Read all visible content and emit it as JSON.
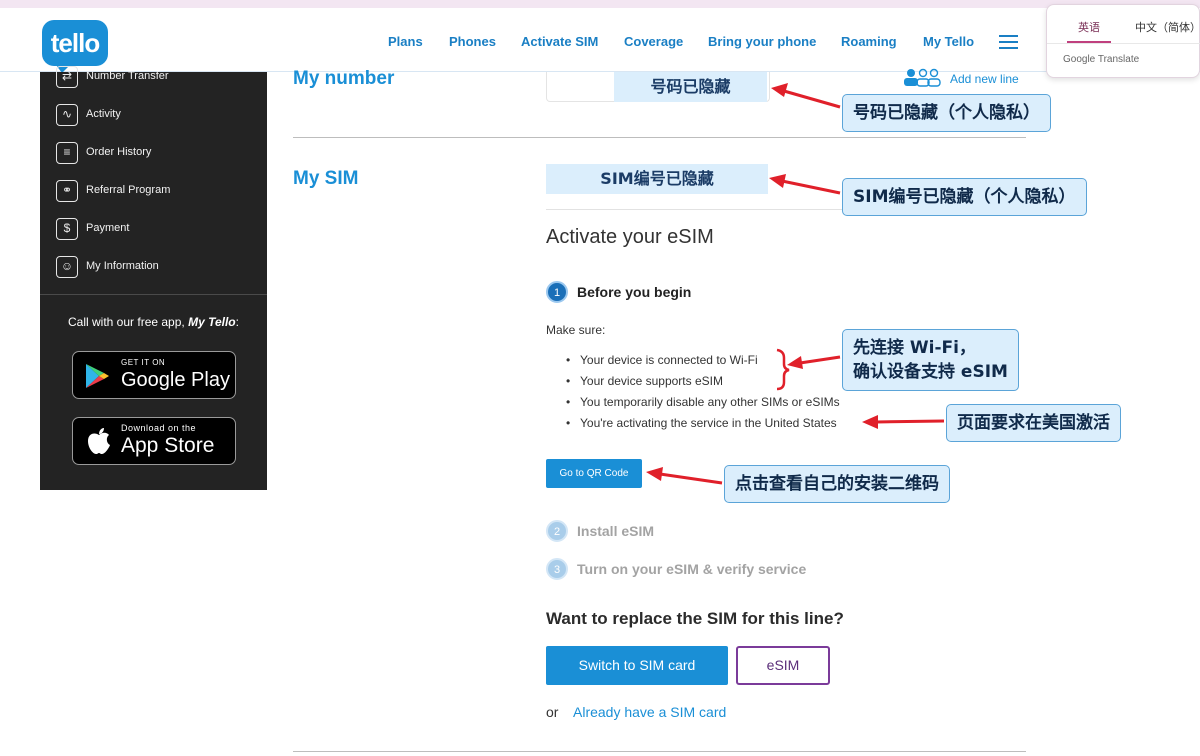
{
  "header": {
    "logo_text": "tello",
    "nav": [
      "Plans",
      "Phones",
      "Activate SIM",
      "Coverage",
      "Bring your phone",
      "Roaming",
      "My Tello"
    ]
  },
  "translate_popup": {
    "tab_english": "英语",
    "tab_chinese": "中文（简体）",
    "brand": "Google Translate"
  },
  "sidebar": {
    "items": [
      {
        "label": "Number Transfer",
        "icon": "number-transfer-icon"
      },
      {
        "label": "Activity",
        "icon": "activity-chart-icon"
      },
      {
        "label": "Order History",
        "icon": "order-list-icon"
      },
      {
        "label": "Referral Program",
        "icon": "referral-icon"
      },
      {
        "label": "Payment",
        "icon": "dollar-icon"
      },
      {
        "label": "My Information",
        "icon": "user-icon"
      }
    ],
    "app_promo_prefix": "Call with our free app,",
    "app_promo_brand": "My Tello",
    "app_promo_suffix": ":",
    "google_play": {
      "small": "GET IT ON",
      "big": "Google Play"
    },
    "app_store": {
      "small": "Download on the",
      "big": "App Store"
    }
  },
  "main": {
    "my_number_title": "My number",
    "number_hidden": "号码已隐藏",
    "add_new_line": "Add new line",
    "my_sim_title": "My SIM",
    "sim_hidden": "SIM编号已隐藏",
    "activate_heading": "Activate your eSIM",
    "steps": [
      {
        "num": "1",
        "title": "Before you begin"
      },
      {
        "num": "2",
        "title": "Install eSIM"
      },
      {
        "num": "3",
        "title": "Turn on your eSIM & verify service"
      }
    ],
    "make_sure": "Make sure:",
    "bullets": [
      "Your device is connected to Wi-Fi",
      "Your device supports eSIM",
      "You temporarily disable any other SIMs or eSIMs",
      "You're activating the service in the United States"
    ],
    "qr_button": "Go to QR Code",
    "replace_heading": "Want to replace the SIM for this line?",
    "switch_button": "Switch to SIM card",
    "esim_button": "eSIM",
    "or_text": "or",
    "already_link": "Already have a SIM card"
  },
  "annotations": {
    "number_note": "号码已隐藏（个人隐私）",
    "sim_note": "SIM编号已隐藏（个人隐私）",
    "wifi_note_line1": "先连接 Wi-Fi，",
    "wifi_note_line2": "确认设备支持 eSIM",
    "us_note": "页面要求在美国激活",
    "qr_note": "点击查看自己的安装二维码"
  },
  "colors": {
    "brand_blue": "#1a8fd6",
    "sidebar_bg": "#232323",
    "callout_bg": "#dbeefc",
    "arrow_red": "#e0202a",
    "esim_border": "#7b3b9a"
  }
}
